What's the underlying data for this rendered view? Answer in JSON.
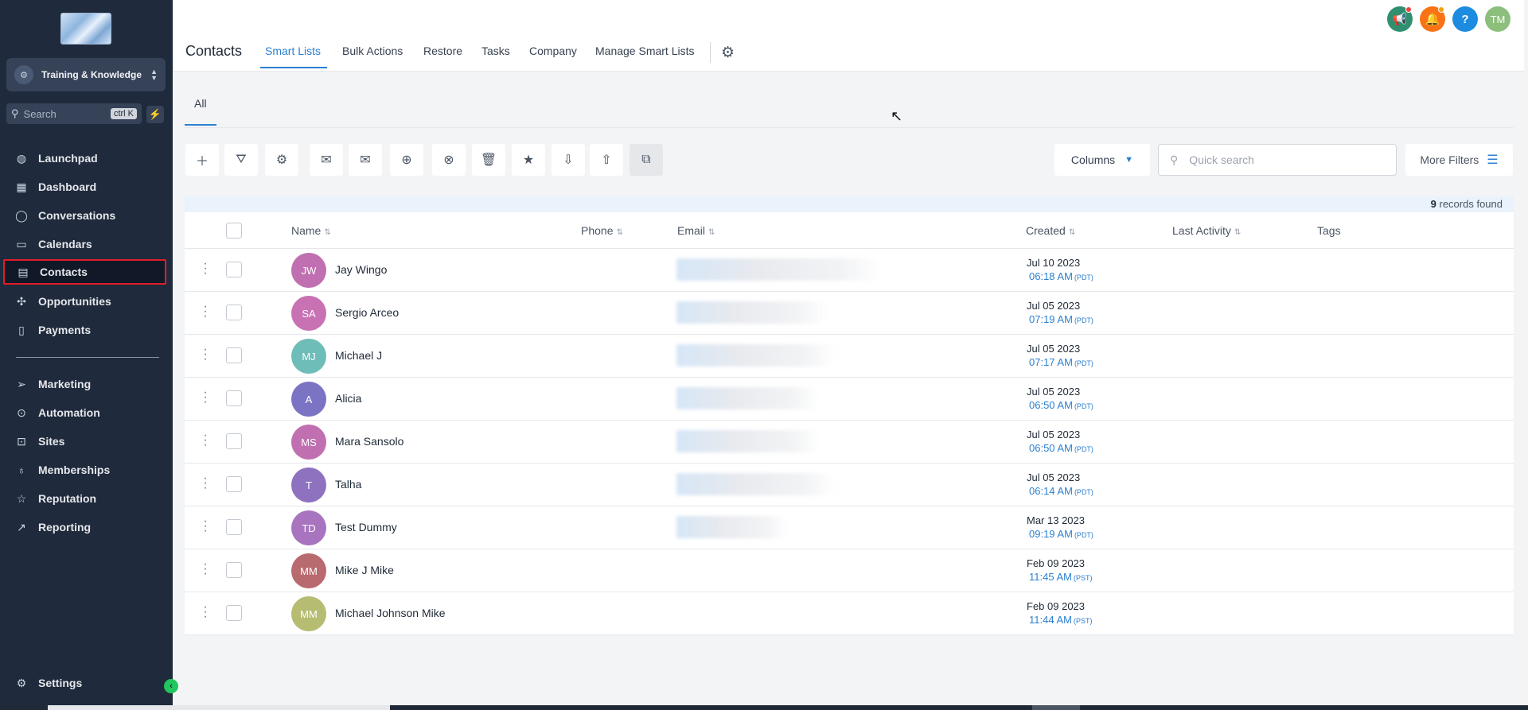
{
  "sidebar": {
    "account_name": "Training & Knowledge",
    "search_placeholder": "Search",
    "search_shortcut": "ctrl K",
    "items": [
      {
        "label": "Launchpad",
        "icon": "launchpad-icon"
      },
      {
        "label": "Dashboard",
        "icon": "dashboard-icon"
      },
      {
        "label": "Conversations",
        "icon": "chat-icon"
      },
      {
        "label": "Calendars",
        "icon": "calendar-icon"
      },
      {
        "label": "Contacts",
        "icon": "contacts-icon",
        "active": true
      },
      {
        "label": "Opportunities",
        "icon": "opportunities-icon"
      },
      {
        "label": "Payments",
        "icon": "payments-icon"
      },
      {
        "label": "Marketing",
        "icon": "send-icon"
      },
      {
        "label": "Automation",
        "icon": "automation-icon"
      },
      {
        "label": "Sites",
        "icon": "sites-icon"
      },
      {
        "label": "Memberships",
        "icon": "memberships-icon"
      },
      {
        "label": "Reputation",
        "icon": "star-icon"
      },
      {
        "label": "Reporting",
        "icon": "reporting-icon"
      }
    ],
    "settings_label": "Settings"
  },
  "header": {
    "title": "Contacts",
    "tabs": [
      {
        "label": "Smart Lists",
        "active": true
      },
      {
        "label": "Bulk Actions"
      },
      {
        "label": "Restore"
      },
      {
        "label": "Tasks"
      },
      {
        "label": "Company"
      },
      {
        "label": "Manage Smart Lists"
      }
    ],
    "user_initials": "TM",
    "help_glyph": "?"
  },
  "subtabs": {
    "all_label": "All"
  },
  "toolbar": {
    "columns_label": "Columns",
    "quick_search_placeholder": "Quick search",
    "more_filters_label": "More Filters"
  },
  "table": {
    "records_count": "9",
    "records_suffix": "records found",
    "columns": [
      "Name",
      "Phone",
      "Email",
      "Created",
      "Last Activity",
      "Tags"
    ],
    "rows": [
      {
        "initials": "JW",
        "name": "Jay Wingo",
        "color": "#c06fb0",
        "date": "Jul 10 2023",
        "time": "06:18 AM",
        "tz": "(PDT)"
      },
      {
        "initials": "SA",
        "name": "Sergio Arceo",
        "color": "#c872b4",
        "date": "Jul 05 2023",
        "time": "07:19 AM",
        "tz": "(PDT)"
      },
      {
        "initials": "MJ",
        "name": "Michael J",
        "color": "#6fbdb8",
        "date": "Jul 05 2023",
        "time": "07:17 AM",
        "tz": "(PDT)"
      },
      {
        "initials": "A",
        "name": "Alicia",
        "color": "#7b74c4",
        "date": "Jul 05 2023",
        "time": "06:50 AM",
        "tz": "(PDT)"
      },
      {
        "initials": "MS",
        "name": "Mara Sansolo",
        "color": "#c06fb0",
        "date": "Jul 05 2023",
        "time": "06:50 AM",
        "tz": "(PDT)"
      },
      {
        "initials": "T",
        "name": "Talha",
        "color": "#8e72c0",
        "date": "Jul 05 2023",
        "time": "06:14 AM",
        "tz": "(PDT)"
      },
      {
        "initials": "TD",
        "name": "Test Dummy",
        "color": "#a874c0",
        "date": "Mar 13 2023",
        "time": "09:19 AM",
        "tz": "(PDT)"
      },
      {
        "initials": "MM",
        "name": "Mike J Mike",
        "color": "#b86a6e",
        "date": "Feb 09 2023",
        "time": "11:45 AM",
        "tz": "(PST)"
      },
      {
        "initials": "MM",
        "name": "Michael Johnson Mike",
        "color": "#b6bc72",
        "date": "Feb 09 2023",
        "time": "11:44 AM",
        "tz": "(PST)"
      }
    ]
  }
}
